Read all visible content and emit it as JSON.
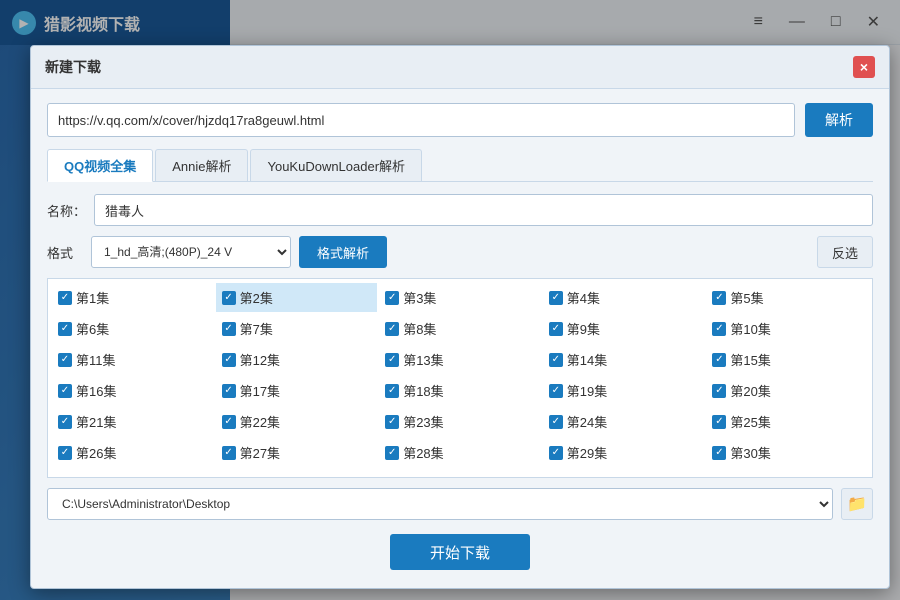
{
  "app": {
    "title": "猎影视频下载",
    "icon": "▶"
  },
  "window_controls": {
    "menu": "≡",
    "minimize": "—",
    "maximize": "□",
    "close": "✕"
  },
  "dialog": {
    "title": "新建下载",
    "close": "×"
  },
  "url_field": {
    "value": "https://v.qq.com/x/cover/hjzdq17ra8geuwl.html",
    "placeholder": ""
  },
  "parse_button": "解析",
  "tabs": [
    {
      "label": "QQ视频全集",
      "active": true
    },
    {
      "label": "Annie解析",
      "active": false
    },
    {
      "label": "YouKuDownLoader解析",
      "active": false
    }
  ],
  "name_field": {
    "label": "名称：",
    "value": "猎毒人"
  },
  "format_field": {
    "label": "格式",
    "value": "1_hd_高清;(480P)_24 V"
  },
  "format_parse_button": "格式解析",
  "reverse_button": "反选",
  "episodes": [
    "第1集",
    "第2集",
    "第3集",
    "第4集",
    "第5集",
    "第6集",
    "第7集",
    "第8集",
    "第9集",
    "第10集",
    "第11集",
    "第12集",
    "第13集",
    "第14集",
    "第15集",
    "第16集",
    "第17集",
    "第18集",
    "第19集",
    "第20集",
    "第21集",
    "第22集",
    "第23集",
    "第24集",
    "第25集",
    "第26集",
    "第27集",
    "第28集",
    "第29集",
    "第30集"
  ],
  "highlighted_episode_index": 1,
  "save_path": {
    "value": "C:\\Users\\Administrator\\Desktop"
  },
  "start_button": "开始下载"
}
